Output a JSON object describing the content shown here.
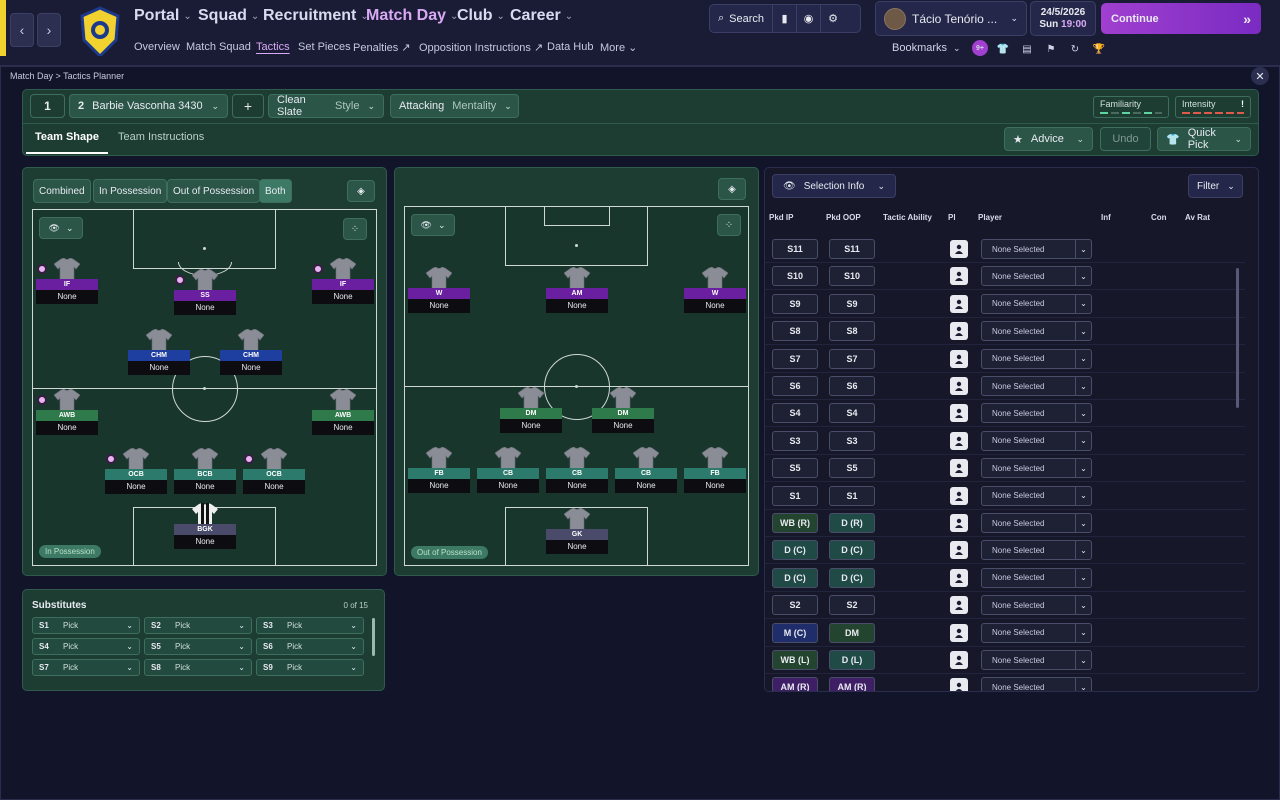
{
  "nav": {
    "back": "‹",
    "forward": "›"
  },
  "menu": [
    {
      "label": "Portal"
    },
    {
      "label": "Squad"
    },
    {
      "label": "Recruitment"
    },
    {
      "label": "Match Day"
    },
    {
      "label": "Club"
    },
    {
      "label": "Career"
    }
  ],
  "submenu": [
    "Overview",
    "Match Squad",
    "Tactics",
    "Set Pieces",
    "Penalties",
    "Opposition Instructions",
    "Data Hub",
    "More"
  ],
  "search": {
    "label": "Search"
  },
  "manager": {
    "name": "Tácio Tenório ..."
  },
  "date": {
    "day": "24/5/2026",
    "time_day": "Sun",
    "time": "19:00"
  },
  "continue": {
    "label": "Continue"
  },
  "bookmarks": {
    "label": "Bookmarks",
    "badge": "9+"
  },
  "breadcrumb": {
    "root": "Match Day",
    "sep": ">",
    "current": "Tactics Planner"
  },
  "tactic": {
    "slot1": "1",
    "slot2": "2",
    "name": "Barbie Vasconha 3430",
    "add": "+",
    "style_value": "Clean Slate",
    "style_label": "Style",
    "mentality_value": "Attacking",
    "mentality_label": "Mentality",
    "familiarity": "Familiarity",
    "intensity": "Intensity",
    "intensity_warn": "!"
  },
  "tabs": {
    "team_shape": "Team Shape",
    "team_instructions": "Team Instructions"
  },
  "actions": {
    "advice": "Advice",
    "undo": "Undo",
    "quick_pick": "Quick Pick"
  },
  "shape_filter": {
    "combined": "Combined",
    "in_possession": "In Possession",
    "out_possession": "Out of Possession",
    "both": "Both"
  },
  "pitch_labels": {
    "in": "In Possession",
    "out": "Out of Possession"
  },
  "in_pos_players": [
    {
      "role": "IF",
      "name": "None",
      "color": "#6a1fa0"
    },
    {
      "role": "SS",
      "name": "None",
      "color": "#6a1fa0"
    },
    {
      "role": "IF",
      "name": "None",
      "color": "#6a1fa0"
    },
    {
      "role": "CHM",
      "name": "None",
      "color": "#1f3fa0"
    },
    {
      "role": "CHM",
      "name": "None",
      "color": "#1f3fa0"
    },
    {
      "role": "AWB",
      "name": "None",
      "color": "#2e7a4a"
    },
    {
      "role": "AWB",
      "name": "None",
      "color": "#2e7a4a"
    },
    {
      "role": "OCB",
      "name": "None",
      "color": "#2c7a6c"
    },
    {
      "role": "BCB",
      "name": "None",
      "color": "#2c7a6c"
    },
    {
      "role": "OCB",
      "name": "None",
      "color": "#2c7a6c"
    },
    {
      "role": "BGK",
      "name": "None",
      "color": "#4a4a6a"
    }
  ],
  "out_pos_players": [
    {
      "role": "W",
      "name": "None",
      "color": "#6a1fa0"
    },
    {
      "role": "AM",
      "name": "None",
      "color": "#6a1fa0"
    },
    {
      "role": "W",
      "name": "None",
      "color": "#6a1fa0"
    },
    {
      "role": "DM",
      "name": "None",
      "color": "#2e7a4a"
    },
    {
      "role": "DM",
      "name": "None",
      "color": "#2e7a4a"
    },
    {
      "role": "FB",
      "name": "None",
      "color": "#2c7a6c"
    },
    {
      "role": "CB",
      "name": "None",
      "color": "#2c7a6c"
    },
    {
      "role": "CB",
      "name": "None",
      "color": "#2c7a6c"
    },
    {
      "role": "CB",
      "name": "None",
      "color": "#2c7a6c"
    },
    {
      "role": "FB",
      "name": "None",
      "color": "#2c7a6c"
    },
    {
      "role": "GK",
      "name": "None",
      "color": "#4a4a6a"
    }
  ],
  "substitutes": {
    "title": "Substitutes",
    "count": "0 of 15",
    "slots": [
      {
        "key": "S1",
        "value": "Pick"
      },
      {
        "key": "S2",
        "value": "Pick"
      },
      {
        "key": "S3",
        "value": "Pick"
      },
      {
        "key": "S4",
        "value": "Pick"
      },
      {
        "key": "S5",
        "value": "Pick"
      },
      {
        "key": "S6",
        "value": "Pick"
      },
      {
        "key": "S7",
        "value": "Pick"
      },
      {
        "key": "S8",
        "value": "Pick"
      },
      {
        "key": "S9",
        "value": "Pick"
      }
    ]
  },
  "selection": {
    "info_label": "Selection Info",
    "filter_label": "Filter",
    "headers": [
      "Pkd IP",
      "Pkd OOP",
      "Tactic Ability",
      "Pl",
      "Player",
      "Inf",
      "Con",
      "Av Rat"
    ],
    "rows": [
      {
        "ip": "S11",
        "oop": "S11",
        "player": "None Selected",
        "ipColor": "#1e2034",
        "oopColor": "#1e2034"
      },
      {
        "ip": "S10",
        "oop": "S10",
        "player": "None Selected",
        "ipColor": "#1e2034",
        "oopColor": "#1e2034"
      },
      {
        "ip": "S9",
        "oop": "S9",
        "player": "None Selected",
        "ipColor": "#1e2034",
        "oopColor": "#1e2034"
      },
      {
        "ip": "S8",
        "oop": "S8",
        "player": "None Selected",
        "ipColor": "#1e2034",
        "oopColor": "#1e2034"
      },
      {
        "ip": "S7",
        "oop": "S7",
        "player": "None Selected",
        "ipColor": "#1e2034",
        "oopColor": "#1e2034"
      },
      {
        "ip": "S6",
        "oop": "S6",
        "player": "None Selected",
        "ipColor": "#1e2034",
        "oopColor": "#1e2034"
      },
      {
        "ip": "S4",
        "oop": "S4",
        "player": "None Selected",
        "ipColor": "#1e2034",
        "oopColor": "#1e2034"
      },
      {
        "ip": "S3",
        "oop": "S3",
        "player": "None Selected",
        "ipColor": "#1e2034",
        "oopColor": "#1e2034"
      },
      {
        "ip": "S5",
        "oop": "S5",
        "player": "None Selected",
        "ipColor": "#1e2034",
        "oopColor": "#1e2034"
      },
      {
        "ip": "S1",
        "oop": "S1",
        "player": "None Selected",
        "ipColor": "#1e2034",
        "oopColor": "#1e2034"
      },
      {
        "ip": "WB (R)",
        "oop": "D (R)",
        "player": "None Selected",
        "ipColor": "#23452f",
        "oopColor": "#1f4a46"
      },
      {
        "ip": "D (C)",
        "oop": "D (C)",
        "player": "None Selected",
        "ipColor": "#1f4a46",
        "oopColor": "#1f4a46"
      },
      {
        "ip": "D (C)",
        "oop": "D (C)",
        "player": "None Selected",
        "ipColor": "#1f4a46",
        "oopColor": "#1f4a46"
      },
      {
        "ip": "S2",
        "oop": "S2",
        "player": "None Selected",
        "ipColor": "#1e2034",
        "oopColor": "#1e2034"
      },
      {
        "ip": "M (C)",
        "oop": "DM",
        "player": "None Selected",
        "ipColor": "#1f2e6a",
        "oopColor": "#23452f"
      },
      {
        "ip": "WB (L)",
        "oop": "D (L)",
        "player": "None Selected",
        "ipColor": "#23452f",
        "oopColor": "#1f4a46"
      },
      {
        "ip": "AM (R)",
        "oop": "AM (R)",
        "player": "None Selected",
        "ipColor": "#3e1f66",
        "oopColor": "#3e1f66"
      }
    ]
  },
  "colors": {
    "accent": "#d9a9f5",
    "continue": "#8a36c8",
    "panel": "#1d3d33"
  }
}
